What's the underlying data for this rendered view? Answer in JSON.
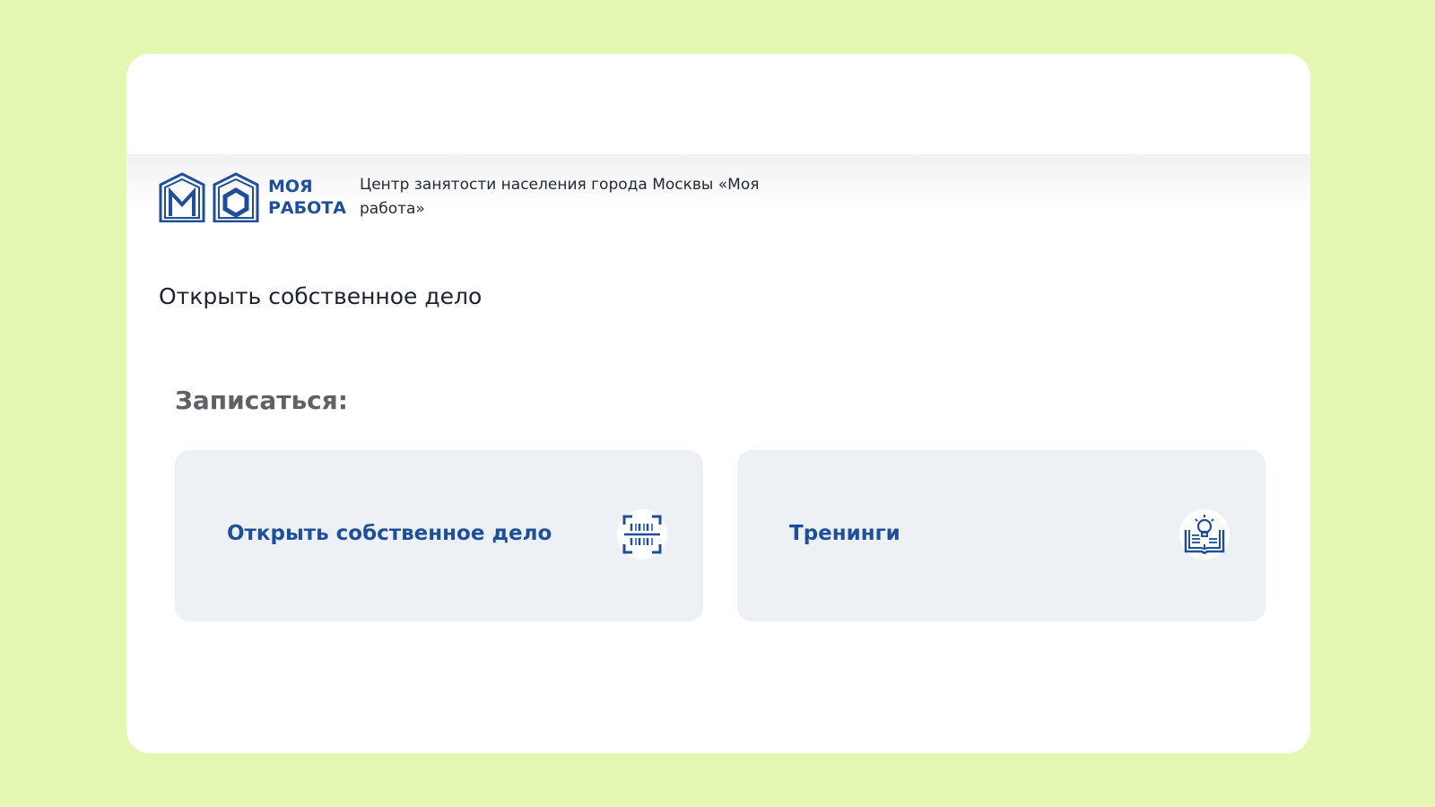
{
  "logo": {
    "line1": "МОЯ",
    "line2": "РАБОТА",
    "icon": "moya-rabota-logo"
  },
  "org_name": "Центр занятости населения города Москвы «Моя работа»",
  "page_heading": "Открыть собственное дело",
  "signup_label": "Записаться:",
  "options": [
    {
      "label": "Открыть собственное дело",
      "icon": "barcode-scan-icon"
    },
    {
      "label": "Тренинги",
      "icon": "book-lightbulb-icon"
    }
  ],
  "colors": {
    "background": "#e4f8b3",
    "brand_blue": "#1e4e9c",
    "option_bg": "#edf1f6"
  }
}
